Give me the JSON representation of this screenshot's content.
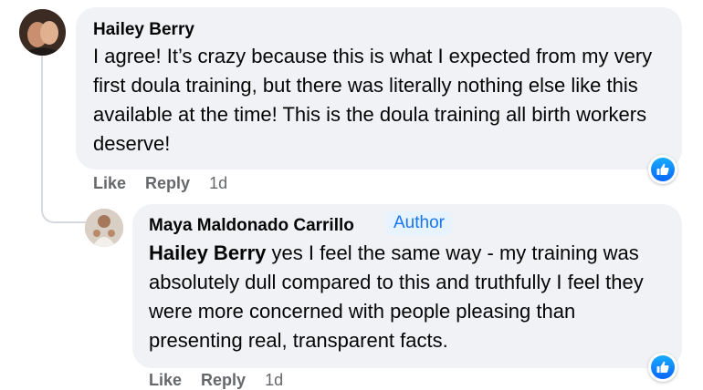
{
  "comments": [
    {
      "author": "Hailey Berry",
      "text": "I agree! It’s crazy because this is what I expected from my very first doula training, but there was literally nothing else like this available at the time! This is the doula training all birth workers deserve!",
      "actions": {
        "like": "Like",
        "reply": "Reply",
        "timestamp": "1d"
      },
      "reaction": "like-icon"
    },
    {
      "author": "Maya Maldonado Carrillo",
      "badge": "Author",
      "mention": "Hailey Berry",
      "text": " yes I feel the same way - my training was absolutely dull compared to this and truthfully I feel they were more concerned with people pleasing than presenting real, transparent facts.",
      "actions": {
        "like": "Like",
        "reply": "Reply",
        "timestamp": "1d"
      },
      "reaction": "like-icon"
    }
  ],
  "colors": {
    "bubble": "#f0f2f5",
    "accent": "#1876f2",
    "badge_bg": "#e7f3ff",
    "meta": "#65676b"
  }
}
